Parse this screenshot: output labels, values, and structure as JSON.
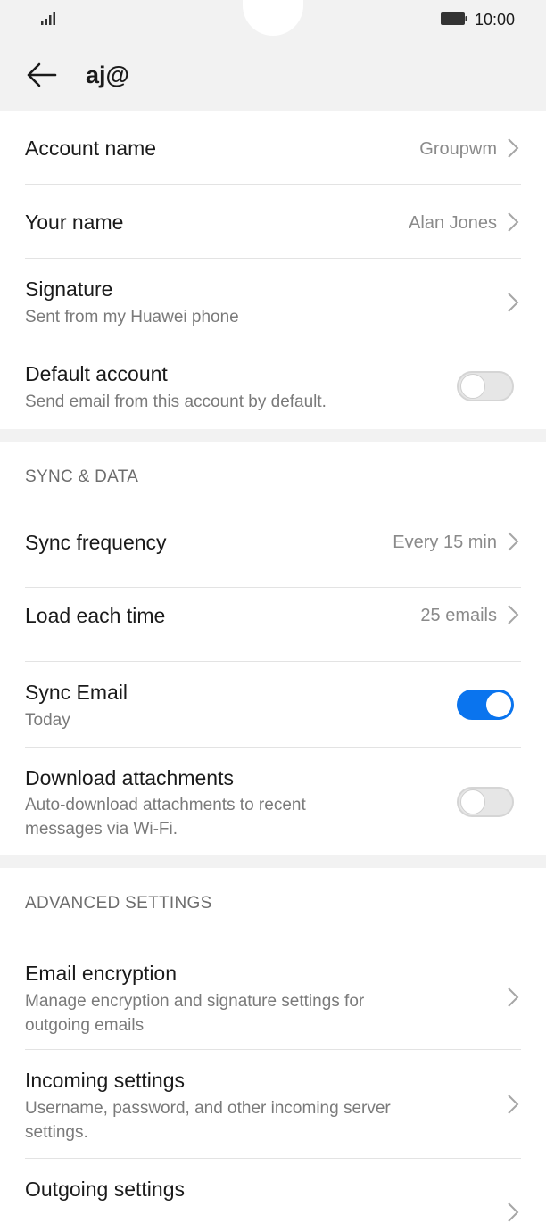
{
  "status_bar": {
    "time": "10:00"
  },
  "header": {
    "title": "aj@"
  },
  "account": {
    "account_name": {
      "label": "Account name",
      "value": "Groupwm"
    },
    "your_name": {
      "label": "Your name",
      "value": "Alan Jones"
    },
    "signature": {
      "label": "Signature",
      "value": "Sent from my Huawei phone"
    },
    "default_account": {
      "label": "Default account",
      "description": "Send email from this account by default.",
      "enabled": false
    }
  },
  "sync": {
    "header": "SYNC & DATA",
    "sync_frequency": {
      "label": "Sync frequency",
      "value": "Every 15 min"
    },
    "load_each_time": {
      "label": "Load each time",
      "value": "25 emails"
    },
    "sync_email": {
      "label": "Sync Email",
      "description": "Today",
      "enabled": true
    },
    "download_attachments": {
      "label": "Download attachments",
      "description_line1": "Auto-download attachments to recent",
      "description_line2": "messages via Wi-Fi.",
      "enabled": false
    }
  },
  "advanced": {
    "header": "ADVANCED SETTINGS",
    "email_encryption": {
      "label": "Email encryption",
      "description_line1": "Manage encryption and signature settings for",
      "description_line2": "outgoing emails"
    },
    "incoming_settings": {
      "label": "Incoming settings",
      "description_line1": "Username, password, and other incoming server",
      "description_line2": "settings."
    },
    "outgoing_settings": {
      "label": "Outgoing settings"
    }
  },
  "colors": {
    "accent": "#0a74ee",
    "background_gray": "#f2f2f2",
    "secondary_text": "#7a7a7a"
  },
  "icons": {
    "back": "arrow-left",
    "chevron": "chevron-right",
    "signal": "signal-bars",
    "battery": "battery"
  }
}
